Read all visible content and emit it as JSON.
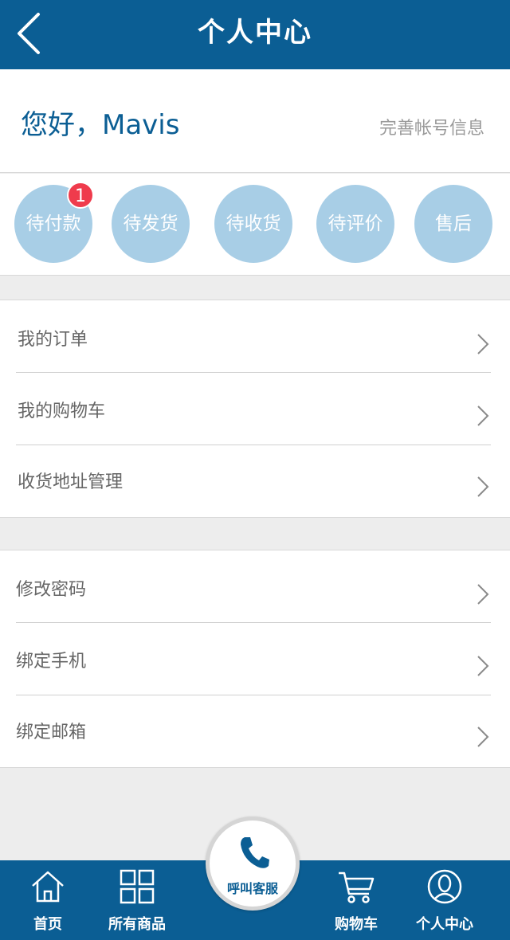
{
  "header": {
    "title": "个人中心",
    "back_icon": "chevron-left-icon"
  },
  "greeting": {
    "hello": "您好，Mavis",
    "complete_info": "完善帐号信息"
  },
  "order_status": {
    "items": [
      {
        "label": "待付款"
      },
      {
        "label": "待发货"
      },
      {
        "label": "待收货"
      },
      {
        "label": "待评价"
      },
      {
        "label": "售后"
      }
    ],
    "badge": "1"
  },
  "menu_group_1": [
    {
      "label": "我的订单"
    },
    {
      "label": "我的购物车"
    },
    {
      "label": "收货地址管理"
    }
  ],
  "menu_group_2": [
    {
      "label": "修改密码"
    },
    {
      "label": "绑定手机"
    },
    {
      "label": "绑定邮箱"
    }
  ],
  "tabbar": {
    "home": "首页",
    "all_products": "所有商品",
    "call_service": "呼叫客服",
    "cart": "购物车",
    "profile": "个人中心"
  },
  "colors": {
    "brand": "#0b5e94",
    "status_circle": "#a8cee6",
    "badge": "#ef3b4c"
  }
}
